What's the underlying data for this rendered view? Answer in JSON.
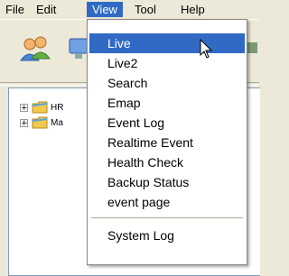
{
  "menubar": {
    "items": [
      {
        "label": "File"
      },
      {
        "label": "Edit"
      },
      {
        "label": "View"
      },
      {
        "label": "Tool"
      },
      {
        "label": "Help"
      }
    ]
  },
  "toolbar": {
    "buttons": [
      {
        "icon": "users-icon"
      },
      {
        "icon": "monitor-icon"
      }
    ]
  },
  "tree": {
    "nodes": [
      {
        "label": "HR"
      },
      {
        "label": "Ma"
      }
    ]
  },
  "view_menu": {
    "items": [
      {
        "label": "Live"
      },
      {
        "label": "Live2"
      },
      {
        "label": "Search"
      },
      {
        "label": "Emap"
      },
      {
        "label": "Event Log"
      },
      {
        "label": "Realtime Event"
      },
      {
        "label": "Health Check"
      },
      {
        "label": "Backup Status"
      },
      {
        "label": "event page"
      },
      {
        "label": "System Log"
      }
    ],
    "highlighted": "Live"
  },
  "colors": {
    "menu_highlight": "#316ac5",
    "window_bg": "#ece9d8"
  }
}
